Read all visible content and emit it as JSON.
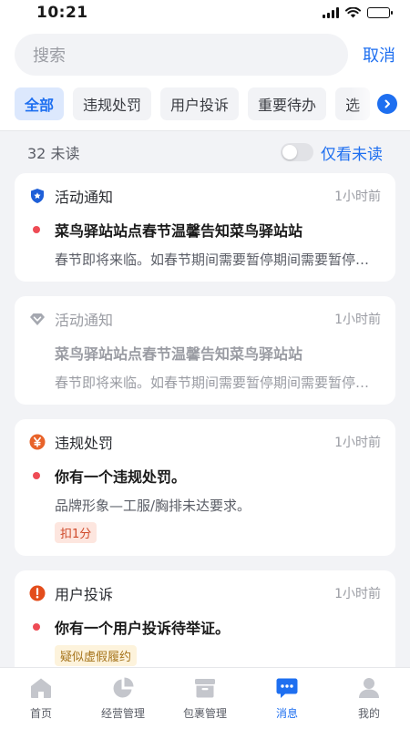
{
  "status_bar": {
    "time": "10:21"
  },
  "search": {
    "placeholder": "搜索",
    "cancel_label": "取消"
  },
  "tabs": [
    {
      "label": "全部",
      "active": true
    },
    {
      "label": "违规处罚",
      "active": false
    },
    {
      "label": "用户投诉",
      "active": false
    },
    {
      "label": "重要待办",
      "active": false
    },
    {
      "label": "选",
      "active": false
    }
  ],
  "unread": {
    "count_text": "32 未读",
    "toggle_label": "仅看未读",
    "toggle_on": false
  },
  "messages": [
    {
      "type": "活动通知",
      "time": "1小时前",
      "title": "菜鸟驿站站点春节温馨告知菜鸟驿站站",
      "desc": "春节即将来临。如春节期间需要暂停期间需要暂停期间",
      "unread": true,
      "icon": "shield-star-icon"
    },
    {
      "type": "活动通知",
      "time": "1小时前",
      "title": "菜鸟驿站站点春节温馨告知菜鸟驿站站",
      "desc": "春节即将来临。如春节期间需要暂停期间需要暂停期间",
      "unread": false,
      "icon": "diamond-icon"
    },
    {
      "type": "违规处罚",
      "time": "1小时前",
      "title": "你有一个违规处罚。",
      "desc": "品牌形象—工服/胸排未达要求。",
      "tag": "扣1分",
      "tag_style": "red",
      "unread": true,
      "icon": "yen-circle-icon"
    },
    {
      "type": "用户投诉",
      "time": "1小时前",
      "title": "你有一个用户投诉待举证。",
      "tag": "疑似虚假履约",
      "tag_style": "yellow",
      "unread": true,
      "icon": "alert-circle-icon"
    }
  ],
  "bottom_nav": [
    {
      "label": "首页",
      "active": false
    },
    {
      "label": "经营管理",
      "active": false
    },
    {
      "label": "包裹管理",
      "active": false
    },
    {
      "label": "消息",
      "active": true
    },
    {
      "label": "我的",
      "active": false
    }
  ],
  "colors": {
    "accent": "#1e6ff0",
    "unread_dot": "#ee4b55",
    "penalty_orange": "#e8632a"
  }
}
